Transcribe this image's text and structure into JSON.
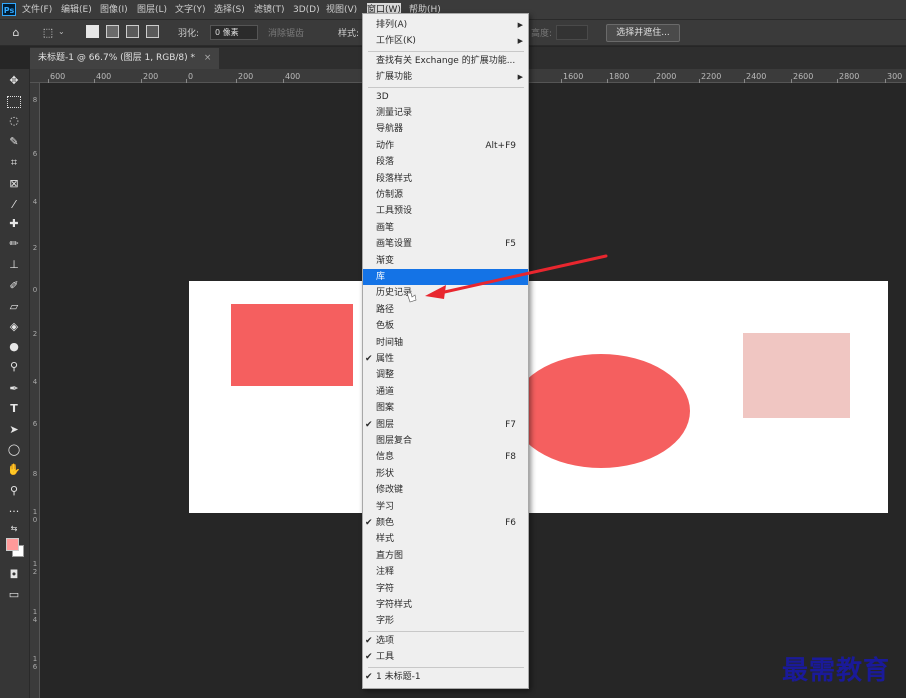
{
  "menubar": {
    "logo": "Ps",
    "items": [
      "文件(F)",
      "编辑(E)",
      "图像(I)",
      "图层(L)",
      "文字(Y)",
      "选择(S)",
      "滤镜(T)",
      "3D(D)",
      "视图(V)",
      "窗口(W)",
      "帮助(H)"
    ]
  },
  "options_bar": {
    "feather_label": "羽化:",
    "feather_value": "0 像素",
    "antialias_label": "消除锯齿",
    "style_label": "样式:",
    "height_label": "高度:",
    "select_mask_label": "选择并遮住..."
  },
  "document_tab": {
    "title": "未标题-1 @ 66.7% (图层 1, RGB/8) *",
    "close": "×"
  },
  "ruler_h_labels": [
    "600",
    "400",
    "200",
    "0",
    "200",
    "400",
    "1600",
    "1800",
    "2000",
    "2200",
    "2400",
    "2600",
    "2800",
    "300"
  ],
  "ruler_v_labels": [
    "8",
    "6",
    "4",
    "2",
    "0",
    "2",
    "4",
    "6",
    "8",
    "1 0",
    "1 2",
    "1 4",
    "1 6"
  ],
  "window_menu": {
    "top_items": [
      {
        "label": "排列(A)",
        "submenu": true
      },
      {
        "label": "工作区(K)",
        "submenu": true
      },
      {
        "label": "查找有关 Exchange 的扩展功能..."
      },
      {
        "label": "扩展功能",
        "submenu": true
      }
    ],
    "panel_items": [
      {
        "label": "3D"
      },
      {
        "label": "测量记录"
      },
      {
        "label": "导航器"
      },
      {
        "label": "动作",
        "shortcut": "Alt+F9"
      },
      {
        "label": "段落"
      },
      {
        "label": "段落样式"
      },
      {
        "label": "仿制源"
      },
      {
        "label": "工具预设"
      },
      {
        "label": "画笔"
      },
      {
        "label": "画笔设置",
        "shortcut": "F5"
      },
      {
        "label": "渐变"
      },
      {
        "label": "库",
        "highlighted": true
      },
      {
        "label": "历史记录"
      },
      {
        "label": "路径"
      },
      {
        "label": "色板"
      },
      {
        "label": "时间轴"
      },
      {
        "label": "属性",
        "checked": true
      },
      {
        "label": "调整"
      },
      {
        "label": "通道"
      },
      {
        "label": "图案"
      },
      {
        "label": "图层",
        "shortcut": "F7",
        "checked": true
      },
      {
        "label": "图层复合"
      },
      {
        "label": "信息",
        "shortcut": "F8"
      },
      {
        "label": "形状"
      },
      {
        "label": "修改键"
      },
      {
        "label": "学习"
      },
      {
        "label": "颜色",
        "shortcut": "F6",
        "checked": true
      },
      {
        "label": "样式"
      },
      {
        "label": "直方图"
      },
      {
        "label": "注释"
      },
      {
        "label": "字符"
      },
      {
        "label": "字符样式"
      },
      {
        "label": "字形"
      }
    ],
    "bottom_items": [
      {
        "label": "选项",
        "checked": true
      },
      {
        "label": "工具",
        "checked": true
      }
    ],
    "document_items": [
      {
        "label": "1 未标题-1",
        "checked": true
      }
    ]
  },
  "canvas_shapes": {
    "rect_red_color": "#f55f5f",
    "ellipse_color": "#f55f5f",
    "rect_pink_color": "#f0c6c2"
  },
  "annotation": {
    "arrow_color": "#e8262e"
  },
  "watermark": "最需教育",
  "colors": {
    "foreground": "#ff9a9a",
    "background": "#ffffff",
    "highlight": "#1473e6"
  }
}
